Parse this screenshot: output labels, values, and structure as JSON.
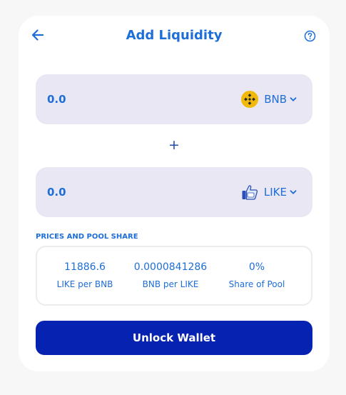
{
  "header": {
    "title": "Add Liquidity"
  },
  "input_a": {
    "amount": "0.0",
    "token": "BNB",
    "token_icon": "bnb-icon",
    "chevron_icon": "chevron-down-icon"
  },
  "plus_symbol": "+",
  "input_b": {
    "amount": "0.0",
    "token": "LIKE",
    "token_icon": "like-thumb-icon",
    "chevron_icon": "chevron-down-icon"
  },
  "pool": {
    "section_label": "PRICES AND POOL SHARE",
    "stats": [
      {
        "value": "11886.6",
        "label": "LIKE per BNB"
      },
      {
        "value": "0.0000841286",
        "label": "BNB per LIKE"
      },
      {
        "value": "0%",
        "label": "Share of Pool"
      }
    ]
  },
  "actions": {
    "unlock_label": "Unlock Wallet"
  },
  "colors": {
    "accent": "#1d6ed8",
    "button": "#0523b0",
    "input_bg": "#eae7f4",
    "bnb_gold": "#f0b90b"
  }
}
